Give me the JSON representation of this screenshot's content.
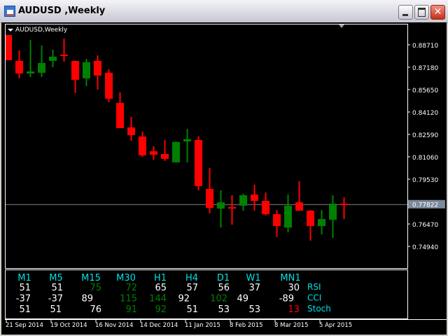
{
  "window": {
    "title": "AUDUSD ,Weekly",
    "close_glyph": "✕"
  },
  "chart": {
    "label": "AUDUSD,Weekly",
    "colors": {
      "bull": "#008000",
      "bear": "#ff0000",
      "grid": "#ffffff",
      "bid": "#808080",
      "bid_box": "#7b8a9c"
    },
    "price_ticks": [
      "0.88710",
      "0.87180",
      "0.85650",
      "0.84120",
      "0.82590",
      "0.81060",
      "0.79530",
      "0.76470",
      "0.74940"
    ],
    "price_tick_values": [
      0.8871,
      0.8718,
      0.8565,
      0.8412,
      0.8259,
      0.8106,
      0.7953,
      0.7647,
      0.7494
    ],
    "current_price": "0.77822",
    "current_price_value": 0.77822,
    "candles": [
      [
        0.8938,
        0.8938,
        0.8766,
        0.8766
      ],
      [
        0.8761,
        0.8833,
        0.8642,
        0.8675
      ],
      [
        0.8675,
        0.8904,
        0.8651,
        0.8689
      ],
      [
        0.868,
        0.8866,
        0.8651,
        0.8747
      ],
      [
        0.8761,
        0.8838,
        0.8718,
        0.879
      ],
      [
        0.8804,
        0.8914,
        0.8756,
        0.8795
      ],
      [
        0.8761,
        0.8761,
        0.8541,
        0.8632
      ],
      [
        0.8642,
        0.8775,
        0.8589,
        0.8752
      ],
      [
        0.8761,
        0.8799,
        0.8565,
        0.8661
      ],
      [
        0.868,
        0.8704,
        0.8479,
        0.8503
      ],
      [
        0.8474,
        0.8546,
        0.8302,
        0.8302
      ],
      [
        0.8307,
        0.8379,
        0.8216,
        0.8254
      ],
      [
        0.8245,
        0.8278,
        0.8106,
        0.8116
      ],
      [
        0.8144,
        0.8178,
        0.8087,
        0.812
      ],
      [
        0.8125,
        0.8221,
        0.8078,
        0.8092
      ],
      [
        0.8068,
        0.8211,
        0.8068,
        0.8207
      ],
      [
        0.8211,
        0.8297,
        0.8068,
        0.8226
      ],
      [
        0.8221,
        0.8245,
        0.7877,
        0.7905
      ],
      [
        0.7886,
        0.803,
        0.7719,
        0.7757
      ],
      [
        0.7752,
        0.7877,
        0.7623,
        0.7795
      ],
      [
        0.7762,
        0.7843,
        0.7642,
        0.7757
      ],
      [
        0.7772,
        0.7853,
        0.7738,
        0.7843
      ],
      [
        0.7848,
        0.7915,
        0.7738,
        0.7805
      ],
      [
        0.7805,
        0.7862,
        0.7705,
        0.7714
      ],
      [
        0.7714,
        0.7743,
        0.7557,
        0.7633
      ],
      [
        0.7623,
        0.7848,
        0.759,
        0.7772
      ],
      [
        0.7795,
        0.7939,
        0.7738,
        0.7738
      ],
      [
        0.7738,
        0.7743,
        0.7533,
        0.7633
      ],
      [
        0.7633,
        0.7743,
        0.7576,
        0.7681
      ],
      [
        0.7676,
        0.7843,
        0.7552,
        0.7786
      ],
      [
        0.7786,
        0.7829,
        0.7681,
        0.7782
      ]
    ],
    "dates": [
      "21 Sep 2014",
      "19 Oct 2014",
      "16 Nov 2014",
      "14 Dec 2014",
      "11 Jan 2015",
      "8 Feb 2015",
      "8 Mar 2015",
      "5 Apr 2015"
    ]
  },
  "indicator": {
    "header_color": "#00e0e0",
    "timeframes": [
      "M1",
      "M5",
      "M15",
      "M30",
      "H1",
      "H4",
      "D1",
      "W1",
      "MN1"
    ],
    "rows": [
      {
        "name": "RSI",
        "values": [
          "51",
          "51",
          "75",
          "72",
          "65",
          "57",
          "56",
          "37",
          "30"
        ],
        "colors": [
          "#ffffff",
          "#ffffff",
          "#008000",
          "#008000",
          "#ffffff",
          "#ffffff",
          "#ffffff",
          "#ffffff",
          "#ffffff"
        ]
      },
      {
        "name": "CCI",
        "values": [
          "-37",
          "-37",
          "89",
          "115",
          "144",
          "92",
          "102",
          "49",
          "-89"
        ],
        "colors": [
          "#ffffff",
          "#ffffff",
          "#ffffff",
          "#008000",
          "#008000",
          "#ffffff",
          "#008000",
          "#ffffff",
          "#ffffff"
        ]
      },
      {
        "name": "Stoch",
        "values": [
          "51",
          "51",
          "76",
          "91",
          "92",
          "51",
          "53",
          "53",
          "13"
        ],
        "colors": [
          "#ffffff",
          "#ffffff",
          "#ffffff",
          "#008000",
          "#008000",
          "#ffffff",
          "#ffffff",
          "#ffffff",
          "#ff0000"
        ]
      }
    ]
  }
}
